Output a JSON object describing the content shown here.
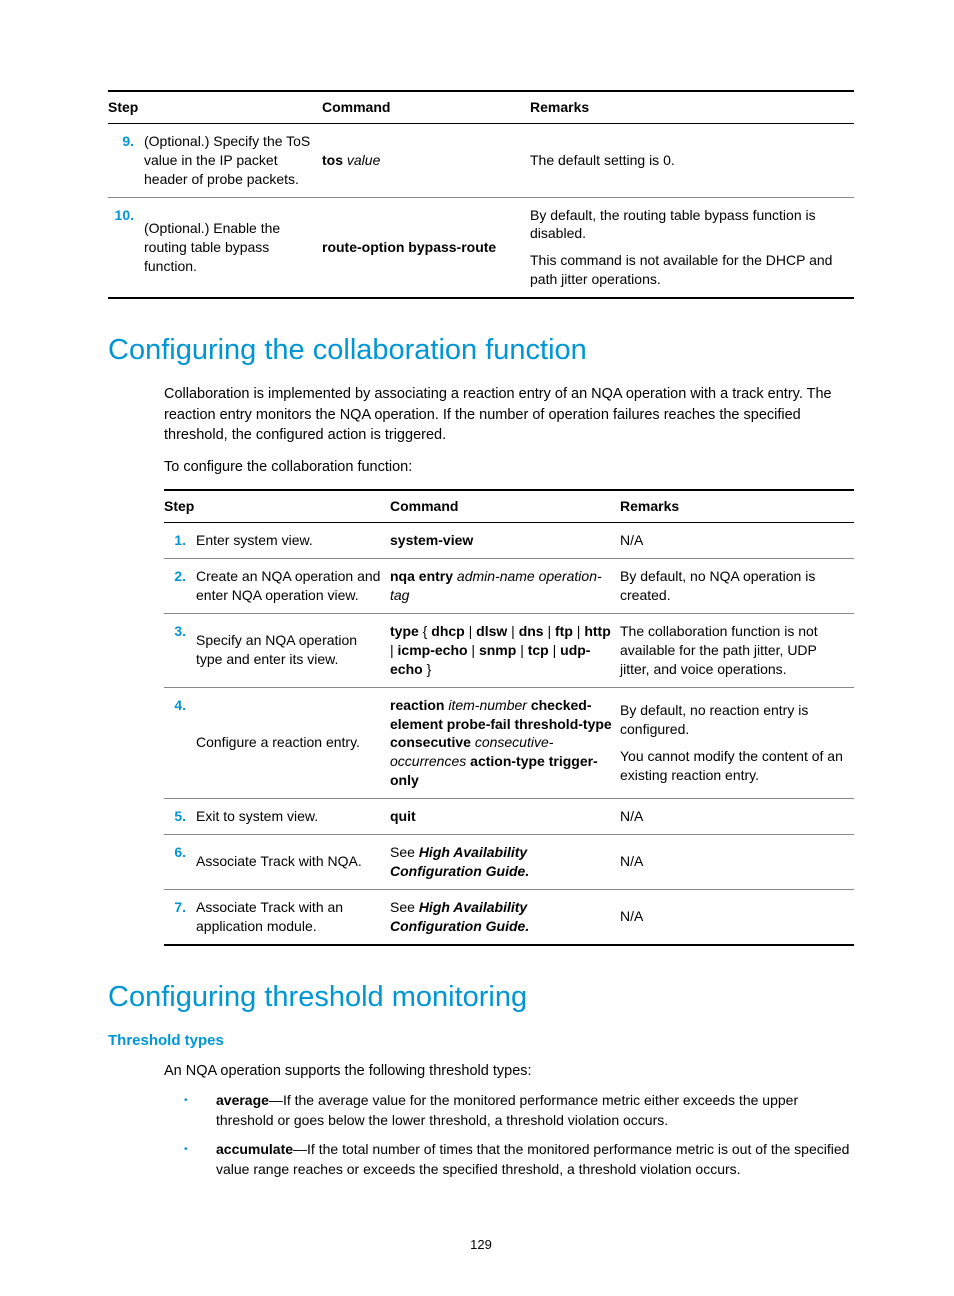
{
  "table1": {
    "headers": [
      "Step",
      "Command",
      "Remarks"
    ],
    "rows": [
      {
        "num": "9.",
        "desc": "(Optional.) Specify the ToS value in the IP packet header of probe packets.",
        "cmd_bold1": "tos",
        "cmd_ital1": " value",
        "remarks": [
          "The default setting is 0."
        ]
      },
      {
        "num": "10.",
        "desc": "(Optional.) Enable the routing table bypass function.",
        "cmd_bold1": "route-option bypass-route",
        "remarks": [
          "By default, the routing table bypass function is disabled.",
          "This command is not available for the DHCP and path jitter operations."
        ]
      }
    ]
  },
  "h1a": "Configuring the collaboration function",
  "para1": "Collaboration is implemented by associating a reaction entry of an NQA operation with a track entry. The reaction entry monitors the NQA operation. If the number of operation failures reaches the specified threshold, the configured action is triggered.",
  "para2": "To configure the collaboration function:",
  "table2": {
    "headers": [
      "Step",
      "Command",
      "Remarks"
    ],
    "rows": [
      {
        "num": "1.",
        "desc": "Enter system view.",
        "cmd_html": "bold:system-view",
        "remarks": [
          "N/A"
        ]
      },
      {
        "num": "2.",
        "desc": "Create an NQA operation and enter NQA operation view.",
        "cmd_html": "nqa-entry",
        "remarks": [
          "By default, no NQA operation is created."
        ]
      },
      {
        "num": "3.",
        "desc": "Specify an NQA operation type and enter its view.",
        "cmd_html": "type-row",
        "remarks": [
          "The collaboration function is not available for the path jitter, UDP jitter, and voice operations."
        ]
      },
      {
        "num": "4.",
        "desc": "Configure a reaction entry.",
        "cmd_html": "reaction-row",
        "remarks": [
          "By default, no reaction entry is configured.",
          "You cannot modify the content of an existing reaction entry."
        ]
      },
      {
        "num": "5.",
        "desc": "Exit to system view.",
        "cmd_html": "bold:quit",
        "remarks": [
          "N/A"
        ]
      },
      {
        "num": "6.",
        "desc": "Associate Track with NQA.",
        "cmd_html": "see-ha",
        "remarks": [
          "N/A"
        ]
      },
      {
        "num": "7.",
        "desc": "Associate Track with an application module.",
        "cmd_html": "see-ha",
        "remarks": [
          "N/A"
        ]
      }
    ],
    "cmd_strings": {
      "nqa_entry": {
        "b": "nqa entry",
        "i": " admin-name operation-tag"
      },
      "type_row": {
        "p1": "type",
        "sep": " { ",
        "o1": "dhcp",
        "bar": " | ",
        "o2": "dlsw",
        "o3": "dns",
        "o4": "ftp",
        "o5": "http",
        "o6": "icmp-echo",
        "o7": "snmp",
        "o8": "tcp",
        "o9": "udp-echo",
        "end": " }"
      },
      "reaction_row": {
        "b1": "reaction",
        "i1": " item-number",
        "b2": "checked-element probe-fail threshold-type consecutive",
        "i2": " consecutive-occurrences",
        "b3": "action-type trigger-only"
      },
      "see_ha": {
        "s": "See ",
        "bi": "High Availability Configuration Guide."
      }
    }
  },
  "h1b": "Configuring threshold monitoring",
  "h2a": "Threshold types",
  "para3": "An NQA operation supports the following threshold types:",
  "bullets": [
    {
      "term": "average",
      "text": "—If the average value for the monitored performance metric either exceeds the upper threshold or goes below the lower threshold, a threshold violation occurs."
    },
    {
      "term": "accumulate",
      "text": "—If the total number of times that the monitored performance metric is out of the specified value range reaches or exceeds the specified threshold, a threshold violation occurs."
    }
  ],
  "page_number": "129"
}
